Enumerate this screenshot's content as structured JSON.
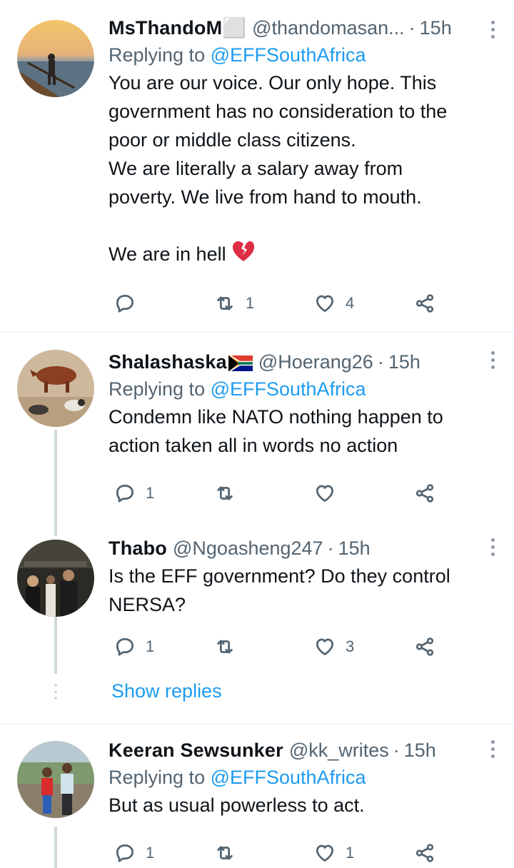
{
  "tweets": [
    {
      "name": "MsThandoM⬜",
      "handle": "@thandomasan...",
      "dot": "·",
      "time": "15h",
      "replying_prefix": "Replying to ",
      "replying_to": "@EFFSouthAfrica",
      "text": "You are our voice. Our only hope. This\ngovernment has no consideration to the\npoor or middle class citizens.\nWe are literally a salary away from\npoverty. We live from hand to mouth.\n\nWe are in hell",
      "emoji": "broken-heart-icon",
      "reply_count": "",
      "retweet_count": "1",
      "like_count": "4"
    },
    {
      "name": "Shalashaska",
      "flag": "south-africa-flag-icon",
      "handle": "@Hoerang26",
      "dot": "·",
      "time": "15h",
      "replying_prefix": "Replying to ",
      "replying_to": "@EFFSouthAfrica",
      "text": "Condemn like NATO nothing happen to\naction taken all in words no action",
      "reply_count": "1",
      "retweet_count": "",
      "like_count": ""
    },
    {
      "name": "Thabo",
      "handle": "@Ngoasheng247",
      "dot": "·",
      "time": "15h",
      "text": "Is the EFF government? Do they control\nNERSA?",
      "reply_count": "1",
      "retweet_count": "",
      "like_count": "3"
    },
    {
      "name": "Keeran Sewsunker",
      "handle": "@kk_writes",
      "dot": "·",
      "time": "15h",
      "replying_prefix": "Replying to ",
      "replying_to": "@EFFSouthAfrica",
      "text": "But as usual powerless to act.",
      "reply_count": "1",
      "retweet_count": "",
      "like_count": "1"
    }
  ],
  "show_replies": "Show replies",
  "colors": {
    "link": "#1d9bf0",
    "secondary": "#536471",
    "thread_line": "#cfd9de"
  }
}
